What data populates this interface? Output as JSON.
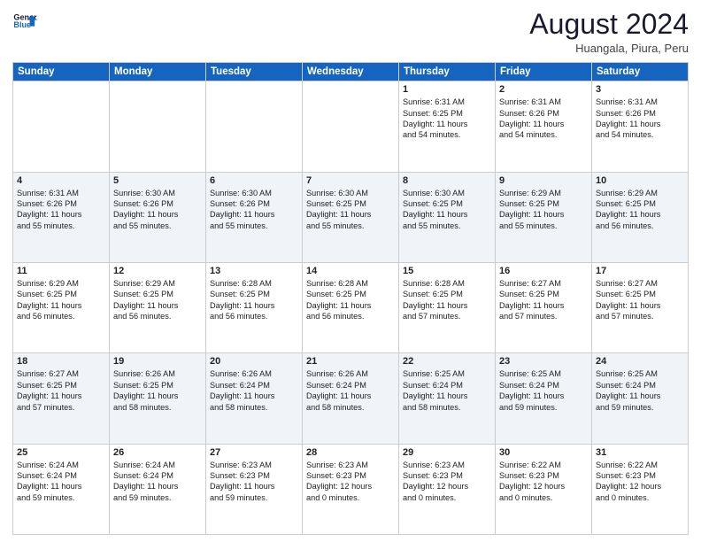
{
  "logo": {
    "line1": "General",
    "line2": "Blue"
  },
  "title": "August 2024",
  "location": "Huangala, Piura, Peru",
  "days_of_week": [
    "Sunday",
    "Monday",
    "Tuesday",
    "Wednesday",
    "Thursday",
    "Friday",
    "Saturday"
  ],
  "weeks": [
    [
      {
        "day": "",
        "info": ""
      },
      {
        "day": "",
        "info": ""
      },
      {
        "day": "",
        "info": ""
      },
      {
        "day": "",
        "info": ""
      },
      {
        "day": "1",
        "info": "Sunrise: 6:31 AM\nSunset: 6:25 PM\nDaylight: 11 hours\nand 54 minutes."
      },
      {
        "day": "2",
        "info": "Sunrise: 6:31 AM\nSunset: 6:26 PM\nDaylight: 11 hours\nand 54 minutes."
      },
      {
        "day": "3",
        "info": "Sunrise: 6:31 AM\nSunset: 6:26 PM\nDaylight: 11 hours\nand 54 minutes."
      }
    ],
    [
      {
        "day": "4",
        "info": "Sunrise: 6:31 AM\nSunset: 6:26 PM\nDaylight: 11 hours\nand 55 minutes."
      },
      {
        "day": "5",
        "info": "Sunrise: 6:30 AM\nSunset: 6:26 PM\nDaylight: 11 hours\nand 55 minutes."
      },
      {
        "day": "6",
        "info": "Sunrise: 6:30 AM\nSunset: 6:26 PM\nDaylight: 11 hours\nand 55 minutes."
      },
      {
        "day": "7",
        "info": "Sunrise: 6:30 AM\nSunset: 6:25 PM\nDaylight: 11 hours\nand 55 minutes."
      },
      {
        "day": "8",
        "info": "Sunrise: 6:30 AM\nSunset: 6:25 PM\nDaylight: 11 hours\nand 55 minutes."
      },
      {
        "day": "9",
        "info": "Sunrise: 6:29 AM\nSunset: 6:25 PM\nDaylight: 11 hours\nand 55 minutes."
      },
      {
        "day": "10",
        "info": "Sunrise: 6:29 AM\nSunset: 6:25 PM\nDaylight: 11 hours\nand 56 minutes."
      }
    ],
    [
      {
        "day": "11",
        "info": "Sunrise: 6:29 AM\nSunset: 6:25 PM\nDaylight: 11 hours\nand 56 minutes."
      },
      {
        "day": "12",
        "info": "Sunrise: 6:29 AM\nSunset: 6:25 PM\nDaylight: 11 hours\nand 56 minutes."
      },
      {
        "day": "13",
        "info": "Sunrise: 6:28 AM\nSunset: 6:25 PM\nDaylight: 11 hours\nand 56 minutes."
      },
      {
        "day": "14",
        "info": "Sunrise: 6:28 AM\nSunset: 6:25 PM\nDaylight: 11 hours\nand 56 minutes."
      },
      {
        "day": "15",
        "info": "Sunrise: 6:28 AM\nSunset: 6:25 PM\nDaylight: 11 hours\nand 57 minutes."
      },
      {
        "day": "16",
        "info": "Sunrise: 6:27 AM\nSunset: 6:25 PM\nDaylight: 11 hours\nand 57 minutes."
      },
      {
        "day": "17",
        "info": "Sunrise: 6:27 AM\nSunset: 6:25 PM\nDaylight: 11 hours\nand 57 minutes."
      }
    ],
    [
      {
        "day": "18",
        "info": "Sunrise: 6:27 AM\nSunset: 6:25 PM\nDaylight: 11 hours\nand 57 minutes."
      },
      {
        "day": "19",
        "info": "Sunrise: 6:26 AM\nSunset: 6:25 PM\nDaylight: 11 hours\nand 58 minutes."
      },
      {
        "day": "20",
        "info": "Sunrise: 6:26 AM\nSunset: 6:24 PM\nDaylight: 11 hours\nand 58 minutes."
      },
      {
        "day": "21",
        "info": "Sunrise: 6:26 AM\nSunset: 6:24 PM\nDaylight: 11 hours\nand 58 minutes."
      },
      {
        "day": "22",
        "info": "Sunrise: 6:25 AM\nSunset: 6:24 PM\nDaylight: 11 hours\nand 58 minutes."
      },
      {
        "day": "23",
        "info": "Sunrise: 6:25 AM\nSunset: 6:24 PM\nDaylight: 11 hours\nand 59 minutes."
      },
      {
        "day": "24",
        "info": "Sunrise: 6:25 AM\nSunset: 6:24 PM\nDaylight: 11 hours\nand 59 minutes."
      }
    ],
    [
      {
        "day": "25",
        "info": "Sunrise: 6:24 AM\nSunset: 6:24 PM\nDaylight: 11 hours\nand 59 minutes."
      },
      {
        "day": "26",
        "info": "Sunrise: 6:24 AM\nSunset: 6:24 PM\nDaylight: 11 hours\nand 59 minutes."
      },
      {
        "day": "27",
        "info": "Sunrise: 6:23 AM\nSunset: 6:23 PM\nDaylight: 11 hours\nand 59 minutes."
      },
      {
        "day": "28",
        "info": "Sunrise: 6:23 AM\nSunset: 6:23 PM\nDaylight: 12 hours\nand 0 minutes."
      },
      {
        "day": "29",
        "info": "Sunrise: 6:23 AM\nSunset: 6:23 PM\nDaylight: 12 hours\nand 0 minutes."
      },
      {
        "day": "30",
        "info": "Sunrise: 6:22 AM\nSunset: 6:23 PM\nDaylight: 12 hours\nand 0 minutes."
      },
      {
        "day": "31",
        "info": "Sunrise: 6:22 AM\nSunset: 6:23 PM\nDaylight: 12 hours\nand 0 minutes."
      }
    ]
  ]
}
